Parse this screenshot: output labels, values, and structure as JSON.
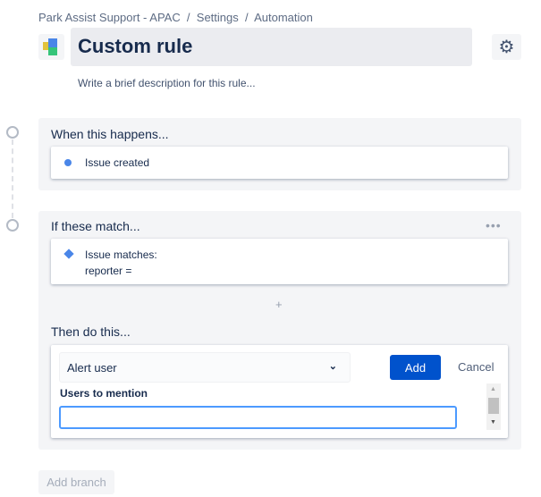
{
  "breadcrumb": "Park Assist Support - APAC  /  Settings  /  Automation",
  "title": "Custom rule",
  "description_placeholder": "Write a brief description for this rule...",
  "trigger": {
    "heading": "When this happens...",
    "item": "Issue created"
  },
  "condition": {
    "heading": "If these match...",
    "line1": "Issue matches:",
    "line2": "reporter =",
    "add": "+"
  },
  "action": {
    "heading": "Then do this...",
    "selected": "Alert user",
    "add_label": "Add",
    "cancel_label": "Cancel",
    "field_label": "Users to mention",
    "field_value": ""
  },
  "add_branch": "Add branch",
  "colors": {
    "accent": "#0052cc",
    "icon": "#4a86e8"
  }
}
